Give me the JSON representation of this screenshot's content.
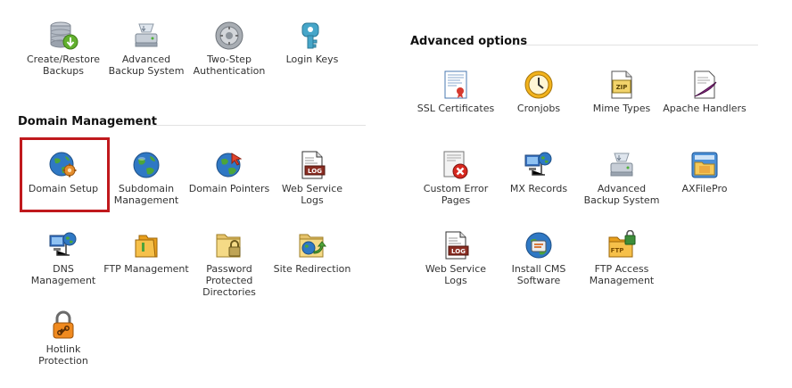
{
  "sections": {
    "domain_management": "Domain Management",
    "advanced_options": "Advanced options"
  },
  "top_row": [
    {
      "label": "Create/Restore Backups",
      "icon": "database-restore-icon"
    },
    {
      "label": "Advanced Backup System",
      "icon": "backup-drive-icon"
    },
    {
      "label": "Two-Step Authentication",
      "icon": "safe-dial-icon"
    },
    {
      "label": "Login Keys",
      "icon": "key-icon"
    }
  ],
  "domain_management": [
    {
      "label": "Domain Setup",
      "icon": "globe-gear-icon",
      "highlighted": true
    },
    {
      "label": "Subdomain Management",
      "icon": "globe-icon"
    },
    {
      "label": "Domain Pointers",
      "icon": "globe-pointer-icon"
    },
    {
      "label": "Web Service Logs",
      "icon": "log-file-icon"
    },
    {
      "label": "DNS Management",
      "icon": "network-computer-icon"
    },
    {
      "label": "FTP Management",
      "icon": "folder-icon"
    },
    {
      "label": "Password Protected Directories",
      "icon": "locked-folder-icon"
    },
    {
      "label": "Site Redirection",
      "icon": "redirect-folder-icon"
    },
    {
      "label": "Hotlink Protection",
      "icon": "padlock-chain-icon"
    }
  ],
  "advanced_options": [
    {
      "label": "SSL Certificates",
      "icon": "certificate-icon"
    },
    {
      "label": "Cronjobs",
      "icon": "clock-icon"
    },
    {
      "label": "Mime Types",
      "icon": "zip-file-icon"
    },
    {
      "label": "Apache Handlers",
      "icon": "feather-icon"
    },
    {
      "label": "Custom Error Pages",
      "icon": "error-page-icon"
    },
    {
      "label": "MX Records",
      "icon": "network-computer-icon"
    },
    {
      "label": "Advanced Backup System",
      "icon": "backup-drive-icon"
    },
    {
      "label": "AXFilePro",
      "icon": "file-manager-icon"
    },
    {
      "label": "Web Service Logs",
      "icon": "log-file-icon"
    },
    {
      "label": "Install CMS Software",
      "icon": "cms-install-icon"
    },
    {
      "label": "FTP Access Management",
      "icon": "ftp-lock-icon"
    }
  ],
  "icon_texts": {
    "log": "LOG",
    "zip": "ZIP",
    "ftp": "FTP"
  }
}
